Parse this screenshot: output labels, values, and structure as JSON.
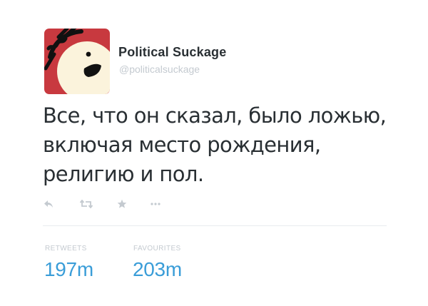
{
  "author": {
    "display_name": "Political Suckage",
    "handle": "@politicalsuckage"
  },
  "tweet": {
    "text_lines": [
      "Все, что он сказал, было ложью,",
      "включая место рождения,",
      "религию и пол."
    ]
  },
  "actions": [
    {
      "name": "reply",
      "icon": "reply-icon"
    },
    {
      "name": "retweet",
      "icon": "retweet-icon"
    },
    {
      "name": "favourite",
      "icon": "star-icon"
    },
    {
      "name": "more",
      "icon": "more-icon"
    }
  ],
  "stats": {
    "retweets_label": "RETWEETS",
    "retweets_value": "197m",
    "favourites_label": "FAVOURITES",
    "favourites_value": "203m"
  },
  "colors": {
    "avatar_background": "#c8393f",
    "link_blue": "#3a9dd8",
    "muted_gray": "#c4cad0",
    "text_dark": "#292f33"
  }
}
